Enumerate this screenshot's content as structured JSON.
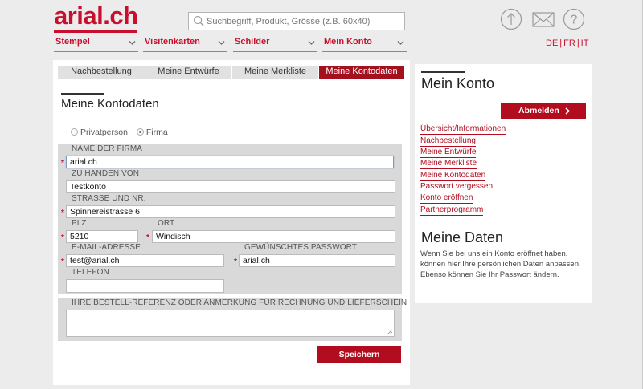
{
  "header": {
    "logo": "arial.ch",
    "search_placeholder": "Suchbegriff, Produkt, Grösse (z.B. 60x40)",
    "icons": [
      "upload-icon",
      "mail-icon",
      "help-icon"
    ],
    "lang": [
      "DE",
      "FR",
      "IT"
    ],
    "lang_sep": "|"
  },
  "nav": [
    {
      "label": "Stempel"
    },
    {
      "label": "Visitenkarten"
    },
    {
      "label": "Schilder"
    },
    {
      "label": "Mein Konto"
    }
  ],
  "tabs": [
    {
      "label": "Nachbestellung",
      "active": false
    },
    {
      "label": "Meine Entwürfe",
      "active": false
    },
    {
      "label": "Meine Merkliste",
      "active": false
    },
    {
      "label": "Meine Kontodaten",
      "active": true
    }
  ],
  "form": {
    "title": "Meine Kontodaten",
    "radio_private": "Privatperson",
    "radio_company": "Firma",
    "selected": "Firma",
    "fields": {
      "company_label": "NAME DER FIRMA",
      "company_value": "arial.ch",
      "attn_label": "ZU HANDEN VON",
      "attn_value": "Testkonto",
      "street_label": "STRASSE UND NR.",
      "street_value": "Spinnereistrasse 6",
      "zip_label": "PLZ",
      "zip_value": "5210",
      "city_label": "ORT",
      "city_value": "Windisch",
      "email_label": "E-MAIL-ADRESSE",
      "email_value": "test@arial.ch",
      "password_label": "GEWÜNSCHTES PASSWORT",
      "password_value": "arial.ch",
      "phone_label": "TELEFON",
      "phone_value": "",
      "ref_label": "IHRE BESTELL-REFERENZ ODER ANMERKUNG FÜR RECHNUNG UND LIEFERSCHEIN",
      "required_mark": "*"
    },
    "save_label": "Speichern"
  },
  "side": {
    "title": "Mein Konto",
    "logout_label": "Abmelden",
    "links": [
      "Übersicht/Informationen",
      "Nachbestellung",
      "Meine Entwürfe",
      "Meine Merkliste",
      "Meine Kontodaten",
      "Passwort vergessen",
      "Konto eröffnen",
      "Partnerprogramm"
    ],
    "data_title": "Meine Daten",
    "data_text": "Wenn Sie bei uns ein Konto eröffnet haben, können hier Ihre persönlichen Daten anpassen. Ebenso können Sie Ihr Passwort ändern."
  },
  "colors": {
    "brand": "#c8102e",
    "button": "#b10d1f",
    "background": "#ececec"
  }
}
